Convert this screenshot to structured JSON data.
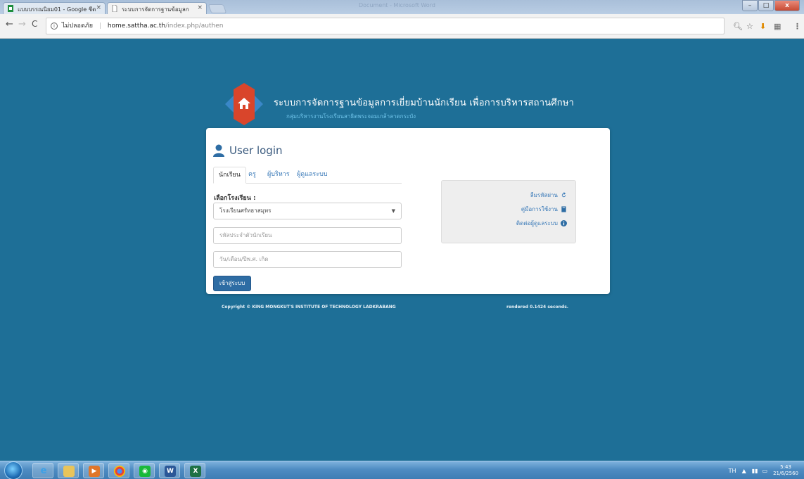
{
  "browser": {
    "tabs": [
      {
        "title": "แบบบรรณนิยม01 - Google ชีต",
        "close": "×"
      },
      {
        "title": "ระบบการจัดการฐานข้อมูลก",
        "close": "×"
      }
    ],
    "window_title": "Document - Microsoft Word",
    "security_label": "ไม่ปลอดภัย",
    "url_host": "home.sattha.ac.th",
    "url_path": "/index.php/authen"
  },
  "header": {
    "title": "ระบบการจัดการฐานข้อมูลการเยี่ยมบ้านนักเรียน เพื่อการบริหารสถานศึกษา",
    "subtitle": "กลุ่มบริหารงานโรงเรียนสาธิตพระจอมเกล้าลาดกระบัง"
  },
  "login": {
    "heading": "User login",
    "tabs": [
      "นักเรียน",
      "ครู",
      "ผู้บริหาร",
      "ผู้ดูแลระบบ"
    ],
    "active_tab": "นักเรียน",
    "school_label": "เลือกโรงเรียน :",
    "school_value": "โรงเรียนศรัทธาสมุทร",
    "student_id_placeholder": "รหัสประจำตัวนักเรียน",
    "birthdate_placeholder": "วัน/เดือน/ปีพ.ศ. เกิด",
    "submit_label": "เข้าสู่ระบบ"
  },
  "help": {
    "forgot_password": "ลืมรหัสผ่าน",
    "manual": "คู่มือการใช้งาน",
    "contact_admin": "ติดต่อผู้ดูแลระบบ"
  },
  "footer": {
    "copyright": "Copyright © KING MONGKUT'S INSTITUTE OF TECHNOLOGY LADKRABANG",
    "rendered": "rendered 0.1424 seconds."
  },
  "taskbar": {
    "lang": "TH",
    "time": "5:43",
    "date": "21/6/2560"
  },
  "colors": {
    "page_bg": "#1e6f97",
    "link": "#3a7ab8",
    "primary_button": "#2e6da4",
    "logo_red": "#d9452b",
    "logo_blue": "#3a87c8"
  }
}
